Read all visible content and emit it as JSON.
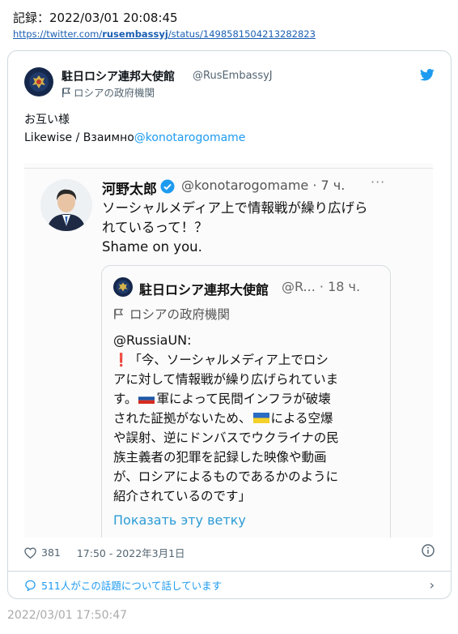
{
  "record": {
    "label": "記録：2022/03/01 20:08:45",
    "link_prefix": "https://twitter.com/",
    "link_user": "rusembassyj",
    "link_suffix": "/status/1498581504213282823"
  },
  "tweet": {
    "author_name": "駐日ロシア連邦大使館",
    "author_handle": "@RusEmbassyJ",
    "author_label": "ロシアの政府機関",
    "text_line1": "お互い様",
    "text_line2_prefix": "Likewise / Взаимно",
    "text_mention": "@konotarogomame",
    "likes": "381",
    "timestamp": "17:50 - 2022年3月1日",
    "conversation": "511人がこの話題について話しています"
  },
  "screenshot": {
    "name": "河野太郎",
    "handle_time": "@konotarogomame · 7 ч.",
    "more": "···",
    "text_line1": "ソーシャルメディア上で情報戦が繰り広げら",
    "text_line2": "れているって！？",
    "text_line3": "Shame on you.",
    "quoted": {
      "name": "駐日ロシア連邦大使館",
      "meta": "@R... · 18 ч.",
      "label": "ロシアの政府機関",
      "handle": "@RussiaUN:",
      "exclaim": "❗",
      "line1": "「今、ソーシャルメディア上でロシ",
      "line2": "アに対して情報戦が繰り広げられていま",
      "line3_a": "す。",
      "line3_b": "軍によって民間インフラが破壊",
      "line4_a": "された証拠がないため、",
      "line4_b": "による空爆",
      "line5": "や誤射、逆にドンバスでウクライナの民",
      "line6": "族主義者の犯罪を記録した映像や動画",
      "line7": "が、ロシアによるものであるかのように",
      "line8": "紹介されているのです」",
      "show_thread": "Показать эту ветку"
    }
  },
  "archive_time": "2022/03/01 17:50:47",
  "colors": {
    "twitter_blue": "#1d9bf0",
    "link_blue": "#1a5fb4",
    "secondary": "#536471"
  }
}
